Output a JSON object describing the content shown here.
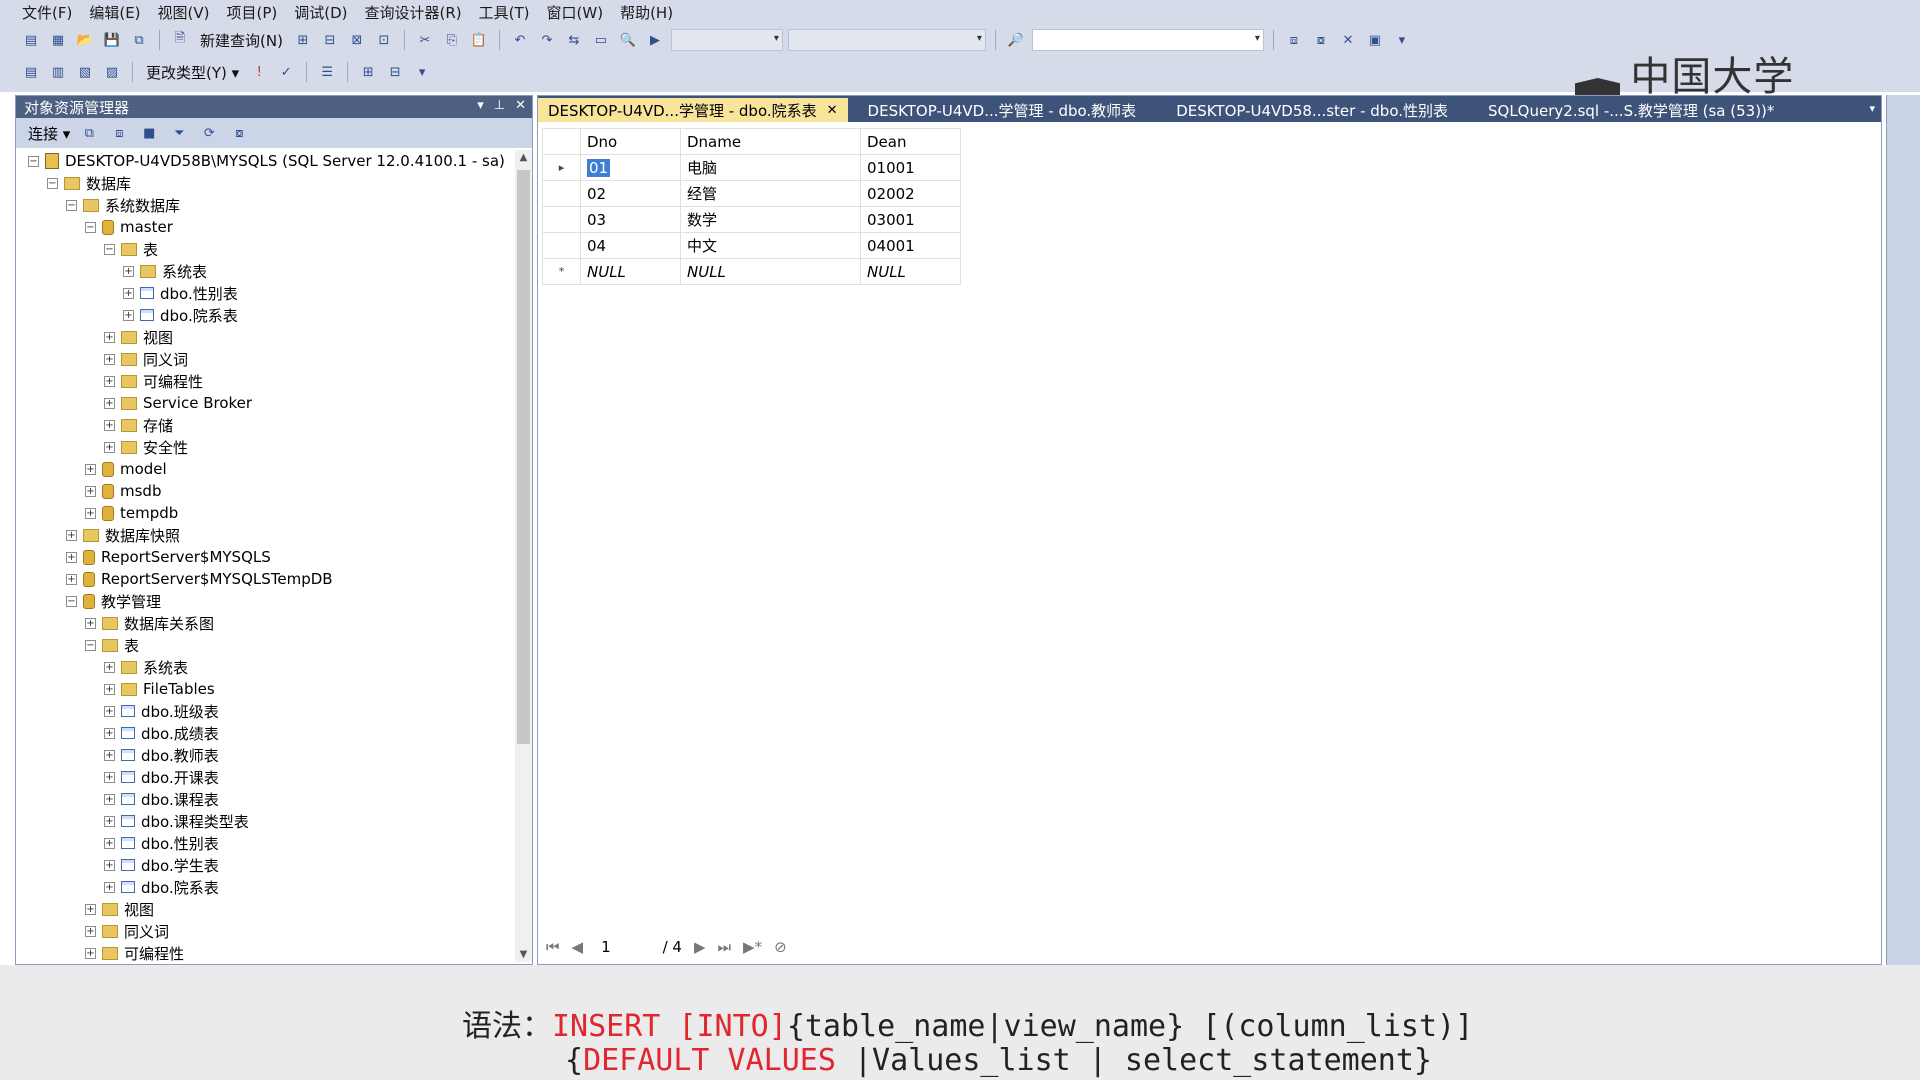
{
  "menu": [
    "文件(F)",
    "编辑(E)",
    "视图(V)",
    "项目(P)",
    "调试(D)",
    "查询设计器(R)",
    "工具(T)",
    "窗口(W)",
    "帮助(H)"
  ],
  "toolbar": {
    "new_query_label": "新建查询(N)",
    "change_type_label": "更改类型(Y)"
  },
  "brand": {
    "logo_text": "中国大学MOOC"
  },
  "object_explorer": {
    "title": "对象资源管理器",
    "connect_label": "连接",
    "tree": [
      {
        "label": "DESKTOP-U4VD58B\\MYSQLS (SQL Server 12.0.4100.1 - sa)",
        "icon": "server-icon",
        "state": "expanded"
      },
      {
        "label": "数据库",
        "icon": "folder-icon",
        "state": "expanded"
      },
      {
        "label": "系统数据库",
        "icon": "folder-icon",
        "state": "expanded"
      },
      {
        "label": "master",
        "icon": "database-icon",
        "state": "expanded"
      },
      {
        "label": "表",
        "icon": "folder-icon",
        "state": "expanded"
      },
      {
        "label": "系统表",
        "icon": "folder-icon",
        "state": "collapsed"
      },
      {
        "label": "dbo.性别表",
        "icon": "table-icon",
        "state": "collapsed"
      },
      {
        "label": "dbo.院系表",
        "icon": "table-icon",
        "state": "collapsed"
      },
      {
        "label": "视图",
        "icon": "folder-icon",
        "state": "collapsed"
      },
      {
        "label": "同义词",
        "icon": "folder-icon",
        "state": "collapsed"
      },
      {
        "label": "可编程性",
        "icon": "folder-icon",
        "state": "collapsed"
      },
      {
        "label": "Service Broker",
        "icon": "folder-icon",
        "state": "collapsed"
      },
      {
        "label": "存储",
        "icon": "folder-icon",
        "state": "collapsed"
      },
      {
        "label": "安全性",
        "icon": "folder-icon",
        "state": "collapsed"
      },
      {
        "label": "model",
        "icon": "database-icon",
        "state": "collapsed"
      },
      {
        "label": "msdb",
        "icon": "database-icon",
        "state": "collapsed"
      },
      {
        "label": "tempdb",
        "icon": "database-icon",
        "state": "collapsed"
      },
      {
        "label": "数据库快照",
        "icon": "folder-icon",
        "state": "collapsed"
      },
      {
        "label": "ReportServer$MYSQLS",
        "icon": "database-icon",
        "state": "collapsed"
      },
      {
        "label": "ReportServer$MYSQLSTempDB",
        "icon": "database-icon",
        "state": "collapsed"
      },
      {
        "label": "教学管理",
        "icon": "database-icon",
        "state": "expanded"
      },
      {
        "label": "数据库关系图",
        "icon": "folder-icon",
        "state": "collapsed"
      },
      {
        "label": "表",
        "icon": "folder-icon",
        "state": "expanded"
      },
      {
        "label": "系统表",
        "icon": "folder-icon",
        "state": "collapsed"
      },
      {
        "label": "FileTables",
        "icon": "folder-icon",
        "state": "collapsed"
      },
      {
        "label": "dbo.班级表",
        "icon": "table-icon",
        "state": "collapsed"
      },
      {
        "label": "dbo.成绩表",
        "icon": "table-icon",
        "state": "collapsed"
      },
      {
        "label": "dbo.教师表",
        "icon": "table-icon",
        "state": "collapsed"
      },
      {
        "label": "dbo.开课表",
        "icon": "table-icon",
        "state": "collapsed"
      },
      {
        "label": "dbo.课程表",
        "icon": "table-icon",
        "state": "collapsed"
      },
      {
        "label": "dbo.课程类型表",
        "icon": "table-icon",
        "state": "collapsed"
      },
      {
        "label": "dbo.性别表",
        "icon": "table-icon",
        "state": "collapsed"
      },
      {
        "label": "dbo.学生表",
        "icon": "table-icon",
        "state": "collapsed"
      },
      {
        "label": "dbo.院系表",
        "icon": "table-icon",
        "state": "collapsed"
      },
      {
        "label": "视图",
        "icon": "folder-icon",
        "state": "collapsed"
      },
      {
        "label": "同义词",
        "icon": "folder-icon",
        "state": "collapsed"
      },
      {
        "label": "可编程性",
        "icon": "folder-icon",
        "state": "collapsed"
      }
    ]
  },
  "tabs": [
    {
      "label": "DESKTOP-U4VD...学管理 - dbo.院系表",
      "active": true
    },
    {
      "label": "DESKTOP-U4VD...学管理 - dbo.教师表",
      "active": false
    },
    {
      "label": "DESKTOP-U4VD58...ster - dbo.性别表",
      "active": false
    },
    {
      "label": "SQLQuery2.sql -...S.教学管理 (sa (53))*",
      "active": false
    }
  ],
  "grid": {
    "columns": [
      "Dno",
      "Dname",
      "Dean"
    ],
    "rows": [
      [
        "01",
        "电脑",
        "01001"
      ],
      [
        "02",
        "经管",
        "02002"
      ],
      [
        "03",
        "数学",
        "03001"
      ],
      [
        "04",
        "中文",
        "04001"
      ],
      [
        "NULL",
        "NULL",
        "NULL"
      ]
    ],
    "row_markers": [
      "▸",
      "",
      "",
      "",
      "*"
    ]
  },
  "pager": {
    "current": "1",
    "total": "/ 4"
  },
  "caption": {
    "prefix": "语法：",
    "kw1": "INSERT",
    "kw2": "[INTO]",
    "rest1": "{table_name|view_name} [(column_list)]",
    "brace_open": "{",
    "kw3": "DEFAULT VALUES",
    "rest2": " |Values_list | select_statement}"
  },
  "colors": {
    "keyword": "#e0262e",
    "active_tab": "#f9e49c",
    "chrome": "#d6dbe9",
    "panel_title": "#4d6082"
  }
}
